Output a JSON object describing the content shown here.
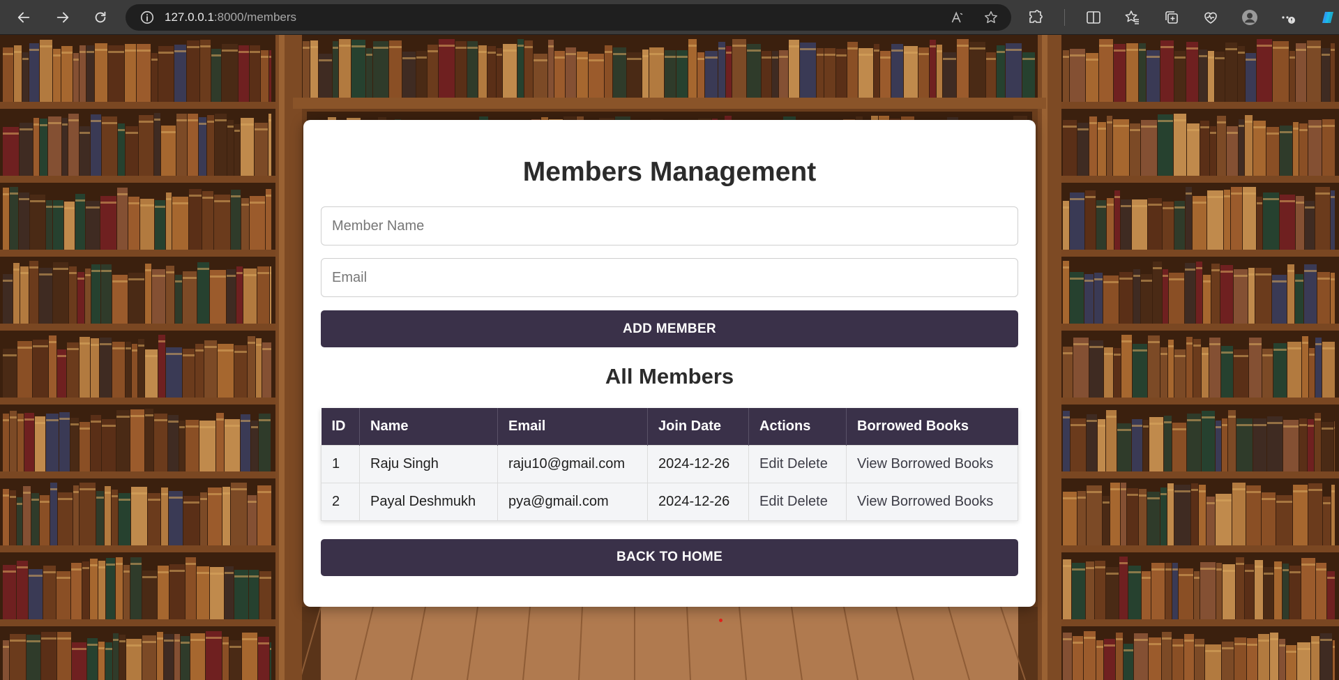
{
  "browser": {
    "url_host": "127.0.0.1",
    "url_path": ":8000/members",
    "icons": [
      "back-arrow-icon",
      "forward-arrow-icon",
      "reload-icon",
      "info-icon",
      "read-aloud-icon",
      "favorite-star-icon",
      "extensions-icon",
      "split-screen-icon",
      "favorites-icon",
      "collections-icon",
      "performance-icon",
      "profile-icon",
      "more-icon",
      "copilot-icon"
    ]
  },
  "page": {
    "title": "Members Management",
    "name_placeholder": "Member Name",
    "email_placeholder": "Email",
    "add_button": "ADD MEMBER",
    "section_title": "All Members",
    "home_button": "BACK TO HOME"
  },
  "table": {
    "headers": [
      "ID",
      "Name",
      "Email",
      "Join Date",
      "Actions",
      "Borrowed Books"
    ],
    "rows": [
      {
        "id": "1",
        "name": "Raju Singh",
        "email": "raju10@gmail.com",
        "join_date": "2024-12-26",
        "edit": "Edit",
        "delete": "Delete",
        "borrowed": "View Borrowed Books"
      },
      {
        "id": "2",
        "name": "Payal Deshmukh",
        "email": "pya@gmail.com",
        "join_date": "2024-12-26",
        "edit": "Edit",
        "delete": "Delete",
        "borrowed": "View Borrowed Books"
      }
    ]
  },
  "colors": {
    "accent": "#3a3149",
    "card": "#ffffff",
    "row_bg": "#f4f5f7"
  }
}
